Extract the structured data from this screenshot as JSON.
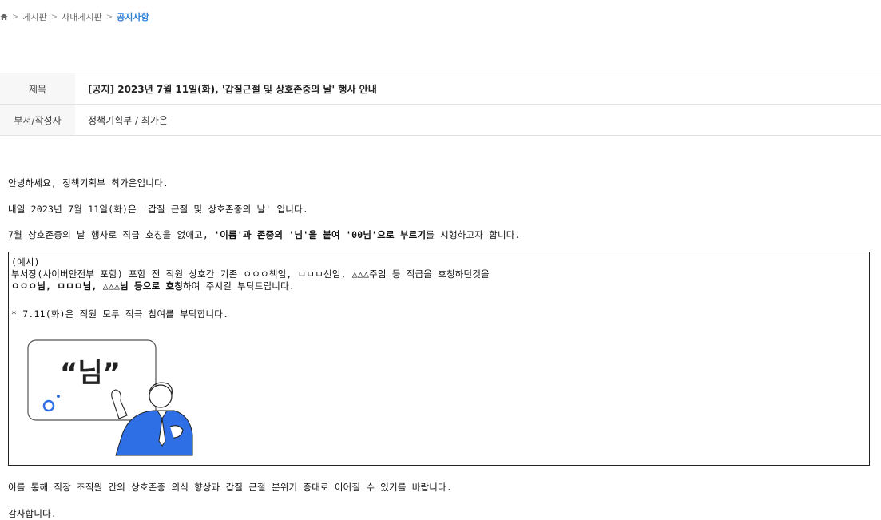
{
  "breadcrumb": {
    "home_icon": "home-icon",
    "items": [
      "게시판",
      "사내게시판"
    ],
    "current": "공지사항",
    "separator": ">"
  },
  "meta": {
    "subject_label": "제목",
    "subject_value": "[공지] 2023년 7월 11일(화), '갑질근절 및 상호존중의 날' 행사 안내",
    "author_label": "부서/작성자",
    "author_value": "정책기획부 / 최가은"
  },
  "body": {
    "greeting": "안녕하세요, 정책기획부 최가은입니다.",
    "line2": "내일 2023년 7월 11일(화)은 '갑질 근절 및 상호존중의 날' 입니다.",
    "line3_prefix": "7월 상호존중의 날 행사로 직급 호칭을 없애고, ",
    "line3_bold": "'이름'과 존중의 '님'을 붙여 '00님'으로 부르기",
    "line3_suffix": "를 시행하고자 합니다.",
    "example": {
      "label": "(예시)",
      "line1": "부서장(사이버안전부 포함) 포함 전 직원 상호간 기존 ㅇㅇㅇ책임, ㅁㅁㅁ선임, △△△주임 등 직급을 호칭하던것을",
      "line2_bold": "ㅇㅇㅇ님, ㅁㅁㅁ님, △△△님 등으로 호칭",
      "line2_suffix": "하여 주시길 부탁드립니다.",
      "note": "* 7.11(화)은 직원 모두 적극 참여를 부탁합니다.",
      "illustration_text": "“님”"
    },
    "closing1": "이를 통해 직장 조직원 간의 상호존중 의식 향상과 갑질 근절 분위기 증대로 이어질 수 있기를 바랍니다.",
    "closing2": "감사합니다."
  },
  "colors": {
    "accent": "#2f80d6",
    "figure_blue": "#2f6fe6",
    "border": "#e3e3e3",
    "header_bg": "#f7f7f7"
  }
}
